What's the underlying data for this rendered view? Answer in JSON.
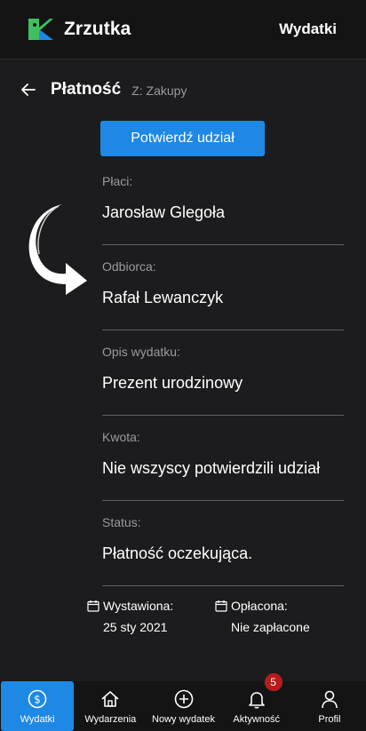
{
  "header": {
    "app_name": "Zrzutka",
    "nav_link": "Wydatki",
    "logo_colors": {
      "green": "#3fbf5f",
      "blue": "#1e88e5"
    }
  },
  "page": {
    "title": "Płatność",
    "subtitle": "Z: Zakupy",
    "confirm_button": "Potwierdź udział"
  },
  "fields": [
    {
      "label": "Płaci:",
      "value": "Jarosław Glegoła"
    },
    {
      "label": "Odbiorca:",
      "value": "Rafał Lewanczyk"
    },
    {
      "label": "Opis wydatku:",
      "value": "Prezent urodzinowy"
    },
    {
      "label": "Kwota:",
      "value": "Nie wszyscy potwierdzili udział"
    },
    {
      "label": "Status:",
      "value": "Płatność oczekująca."
    }
  ],
  "dates": {
    "issued_label": "Wystawiona:",
    "issued_value": "25 sty 2021",
    "paid_label": "Opłacona:",
    "paid_value": "Nie zapłacone"
  },
  "bottom_nav": {
    "items": [
      {
        "label": "Wydatki",
        "icon": "dollar-circle-icon",
        "active": true
      },
      {
        "label": "Wydarzenia",
        "icon": "home-icon"
      },
      {
        "label": "Nowy wydatek",
        "icon": "plus-circle-icon"
      },
      {
        "label": "Aktywność",
        "icon": "bell-icon",
        "badge": "5"
      },
      {
        "label": "Profil",
        "icon": "user-icon"
      }
    ]
  },
  "colors": {
    "accent": "#1e88e5",
    "background": "#1c1c1e",
    "topbar": "#141415",
    "badge": "#b71c1c"
  }
}
